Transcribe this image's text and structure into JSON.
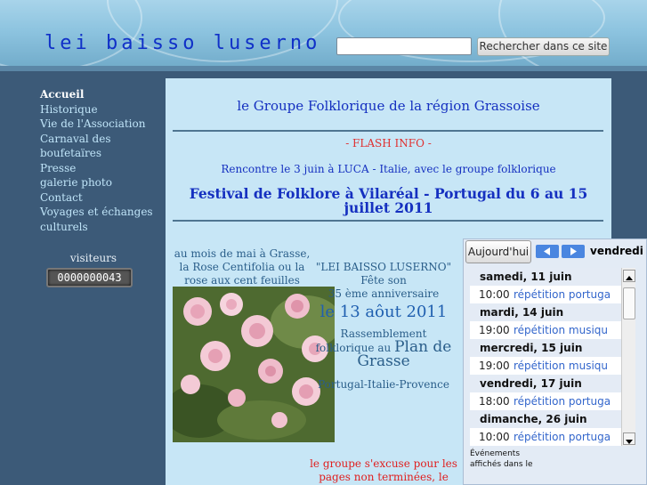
{
  "header": {
    "site_title": "lei baisso luserno",
    "search_placeholder": "",
    "search_button": "Rechercher dans ce site"
  },
  "nav": {
    "items": [
      {
        "label": "Accueil",
        "active": true
      },
      {
        "label": "Historique"
      },
      {
        "label": "Vie de l'Association"
      },
      {
        "label": "Carnaval des boufetaïres"
      },
      {
        "label": "Presse"
      },
      {
        "label": "galerie photo"
      },
      {
        "label": "Contact"
      },
      {
        "label": "Voyages et échanges culturels"
      }
    ],
    "visitors_label": "visiteurs",
    "visitor_count": "0000000043"
  },
  "main": {
    "title": "le Groupe Folklorique de la région Grassoise",
    "flash": "- FLASH INFO  -",
    "rencontre": "Rencontre le 3 juin à LUCA - Italie, avec le groupe folklorique",
    "festival": "Festival de Folklore à Vilaréal - Portugal du 6 au 15 juillet 2011",
    "rose_caption": "au mois de mai à Grasse, la Rose Centifolia ou la rose aux cent feuilles",
    "anniv_name": "\"LEI BAISSO LUSERNO\"",
    "anniv_fete": "Fête son",
    "anniv_years": "35 ème anniversaire",
    "anniv_date": "le 13 aôut 2011",
    "rassemblement": "Rassemblement folklorique au",
    "plan": "Plan de Grasse",
    "countries": "Portugal-Italie-Provence",
    "excuse": "le groupe s'excuse pour les pages non terminées, le site"
  },
  "calendar": {
    "today_button": "Aujourd'hui",
    "current_date": "vendredi",
    "days": [
      {
        "day": "samedi, 11 juin",
        "events": [
          {
            "time": "10:00",
            "title": "répétition portuga"
          }
        ]
      },
      {
        "day": "mardi, 14 juin",
        "events": [
          {
            "time": "19:00",
            "title": "répétition musiqu"
          }
        ]
      },
      {
        "day": "mercredi, 15 juin",
        "events": [
          {
            "time": "19:00",
            "title": "répétition musiqu"
          }
        ]
      },
      {
        "day": "vendredi, 17 juin",
        "events": [
          {
            "time": "18:00",
            "title": "répétition portuga"
          }
        ]
      },
      {
        "day": "dimanche, 26 juin",
        "events": [
          {
            "time": "10:00",
            "title": "répétition portuga"
          }
        ]
      }
    ],
    "footer": "Événements affichés dans le"
  },
  "colors": {
    "title_blue": "#1030c8",
    "flash_red": "#e03030",
    "sidebar": "#3c5a78",
    "content_bg": "#c7e6f6"
  }
}
